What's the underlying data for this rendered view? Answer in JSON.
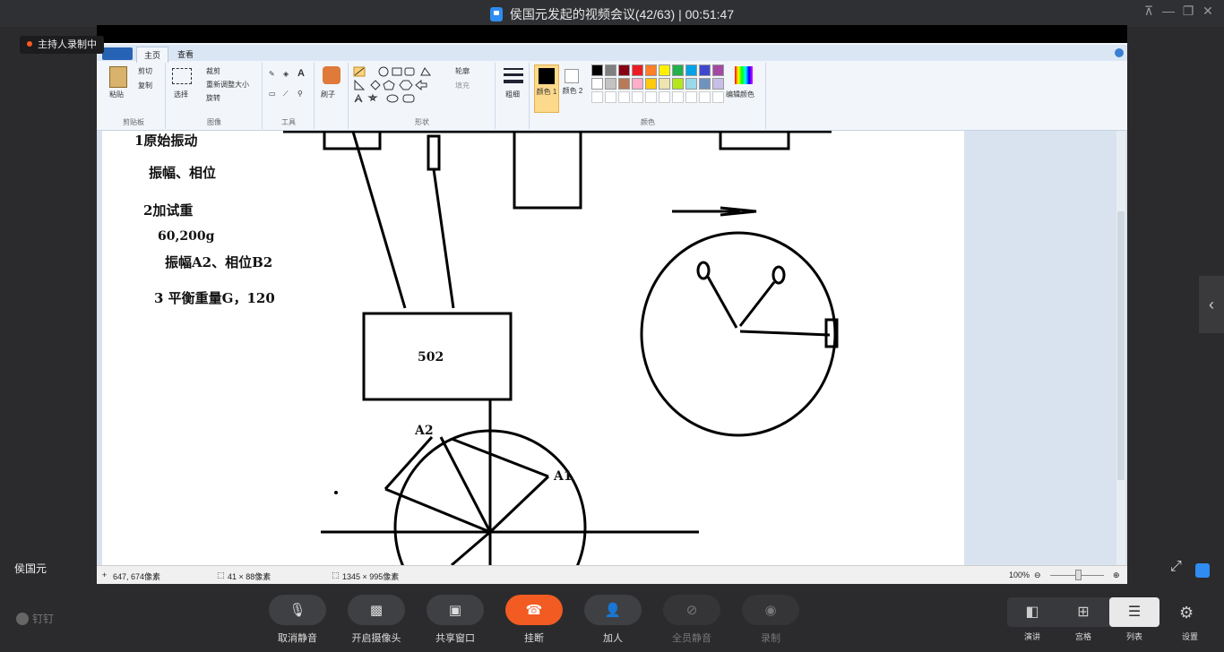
{
  "window": {
    "title": "侯国元发起的视频会议(42/63) | 00:51:47"
  },
  "recording": {
    "label": "主持人录制中"
  },
  "paint": {
    "tabs": [
      "主页",
      "查看"
    ],
    "groups": {
      "clipboard": {
        "paste": "粘贴",
        "cut": "剪切",
        "copy": "复制",
        "label": "剪贴板"
      },
      "image": {
        "select": "选择",
        "crop": "裁剪",
        "resize": "重新调整大小",
        "rotate": "旋转",
        "label": "图像"
      },
      "tools": {
        "label": "工具"
      },
      "brushes": {
        "label": "刷子"
      },
      "shapes": {
        "outline": "轮廓",
        "fill": "填充",
        "label": "形状"
      },
      "size": {
        "label": "粗细"
      },
      "colors": {
        "color1": "颜色 1",
        "color2": "颜色 2",
        "edit": "编辑颜色",
        "label": "颜色"
      }
    },
    "palette": [
      "#000000",
      "#7f7f7f",
      "#880015",
      "#ed1c24",
      "#ff7f27",
      "#fff200",
      "#22b14c",
      "#00a2e8",
      "#3f48cc",
      "#a349a4",
      "#ffffff",
      "#c3c3c3",
      "#b97a57",
      "#ffaec9",
      "#ffc90e",
      "#efe4b0",
      "#b5e61d",
      "#99d9ea",
      "#7092be",
      "#c8bfe7"
    ],
    "status": {
      "cursor": "647, 674像素",
      "selection": "41 × 88像素",
      "size": "1345 × 995像素",
      "zoom": "100%"
    },
    "canvas_text": {
      "line1": "1原始振动",
      "line2": "振幅、相位",
      "line3": "2加试重",
      "line4": "60,200g",
      "line5": "振幅A2、相位B2",
      "line6": "3 平衡重量G，120",
      "box": "502",
      "a2": "A2",
      "a1": "A1"
    }
  },
  "speaker": {
    "name": "侯国元"
  },
  "brand": {
    "label": "钉钉"
  },
  "controls": [
    {
      "label": "取消静音"
    },
    {
      "label": "开启摄像头"
    },
    {
      "label": "共享窗口"
    },
    {
      "label": "挂断"
    },
    {
      "label": "加人"
    },
    {
      "label": "全员静音"
    },
    {
      "label": "录制"
    }
  ],
  "layouts": [
    {
      "label": "演讲"
    },
    {
      "label": "宫格"
    },
    {
      "label": "列表"
    }
  ],
  "settings": {
    "label": "设置"
  }
}
